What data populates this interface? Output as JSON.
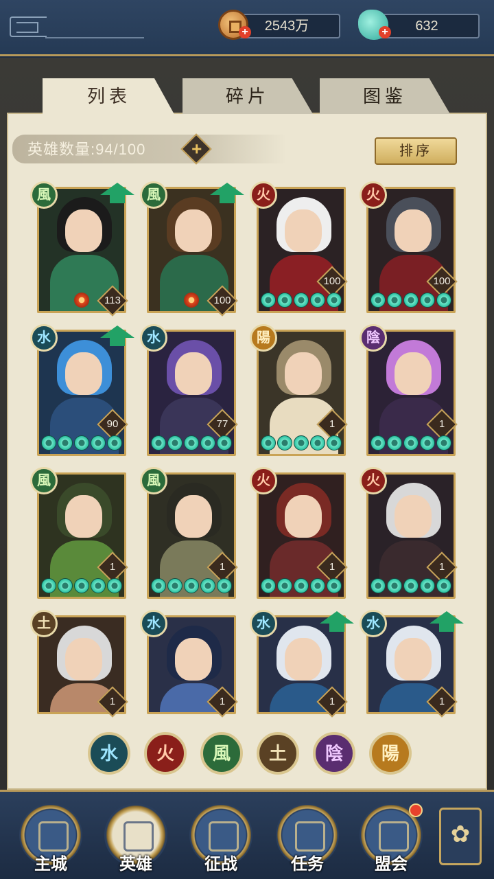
{
  "resources": {
    "coins": "2543万",
    "jade": "632"
  },
  "tabs": [
    {
      "label": "列表",
      "active": true
    },
    {
      "label": "碎片",
      "active": false
    },
    {
      "label": "图鉴",
      "active": false
    }
  ],
  "hero_count_label": "英雄数量:94/100",
  "sort_label": "排序",
  "elements": {
    "wind": "風",
    "fire": "火",
    "water": "水",
    "earth": "土",
    "yin": "陰",
    "yang": "陽"
  },
  "heroes": [
    {
      "element": "風",
      "level": "113",
      "stars": 0,
      "upgrade": true
    },
    {
      "element": "風",
      "level": "100",
      "stars": 0,
      "upgrade": true
    },
    {
      "element": "火",
      "level": "100",
      "stars": 5,
      "upgrade": false
    },
    {
      "element": "火",
      "level": "100",
      "stars": 5,
      "upgrade": false
    },
    {
      "element": "水",
      "level": "90",
      "stars": 5,
      "upgrade": true
    },
    {
      "element": "水",
      "level": "77",
      "stars": 5,
      "upgrade": false
    },
    {
      "element": "陽",
      "level": "1",
      "stars": 5,
      "upgrade": false
    },
    {
      "element": "陰",
      "level": "1",
      "stars": 5,
      "upgrade": false
    },
    {
      "element": "風",
      "level": "1",
      "stars": 5,
      "upgrade": false
    },
    {
      "element": "風",
      "level": "1",
      "stars": 5,
      "upgrade": false
    },
    {
      "element": "火",
      "level": "1",
      "stars": 5,
      "upgrade": false
    },
    {
      "element": "火",
      "level": "1",
      "stars": 5,
      "upgrade": false
    },
    {
      "element": "土",
      "level": "1",
      "stars": 0,
      "upgrade": false
    },
    {
      "element": "水",
      "level": "1",
      "stars": 0,
      "upgrade": false
    },
    {
      "element": "水",
      "level": "1",
      "stars": 0,
      "upgrade": true
    },
    {
      "element": "水",
      "level": "1",
      "stars": 0,
      "upgrade": true
    }
  ],
  "filters": [
    "水",
    "火",
    "風",
    "土",
    "陰",
    "陽"
  ],
  "nav": [
    {
      "label": "主城",
      "icon": "castle-icon"
    },
    {
      "label": "英雄",
      "icon": "hero-portrait-icon",
      "active": true
    },
    {
      "label": "征战",
      "icon": "battle-icon"
    },
    {
      "label": "任务",
      "icon": "quest-icon"
    },
    {
      "label": "盟会",
      "icon": "guild-icon",
      "badge": true
    }
  ],
  "colors": {
    "accent_gold": "#c9a356",
    "panel_bg": "#ece6d2",
    "nav_bg": "#1c2b42",
    "upgrade_green": "#22a266",
    "notify_red": "#e8422c"
  }
}
